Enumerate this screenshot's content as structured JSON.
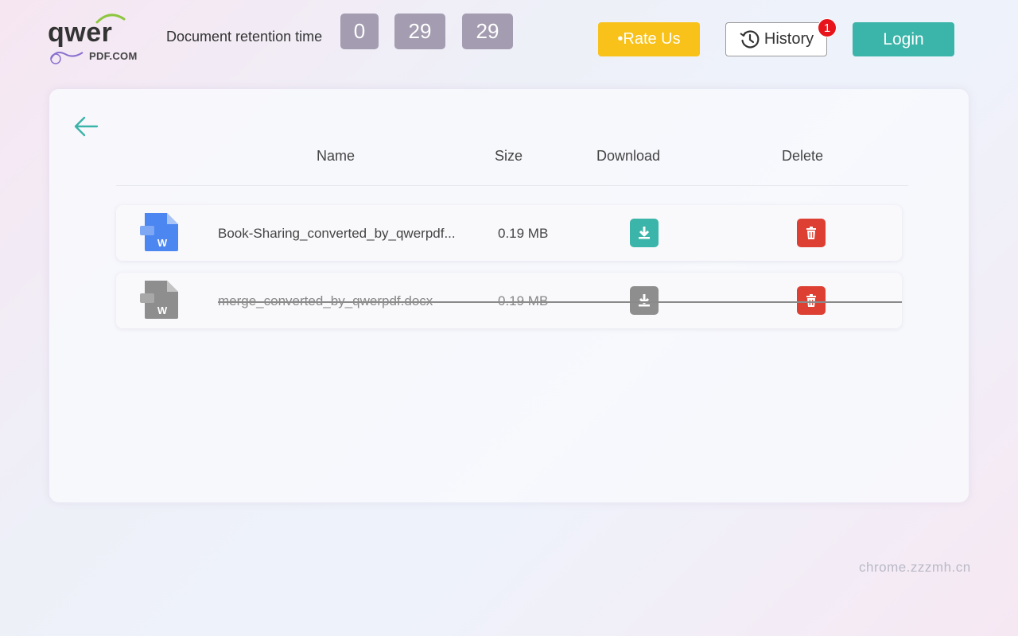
{
  "header": {
    "logo_text": "qwer",
    "logo_sub": "PDF.COM",
    "retention_label": "Document retention time",
    "timer": [
      "0",
      "29",
      "29"
    ],
    "rate_label": "•Rate Us",
    "history_label": "History",
    "history_badge": "1",
    "login_label": "Login"
  },
  "table": {
    "headers": {
      "name": "Name",
      "size": "Size",
      "download": "Download",
      "delete": "Delete"
    },
    "rows": [
      {
        "name": "Book-Sharing_converted_by_qwerpdf...",
        "size": "0.19 MB",
        "icon_color": "#4c86f0",
        "struck": false
      },
      {
        "name": "merge_converted_by_qwerpdf.docx",
        "size": "0.19 MB",
        "icon_color": "#8e8e8e",
        "struck": true
      }
    ]
  },
  "watermark": "chrome.zzzmh.cn",
  "colors": {
    "accent": "#3bb4a9",
    "rate": "#f8c21a",
    "delete": "#dd3f32",
    "timer": "#a49cb0"
  }
}
